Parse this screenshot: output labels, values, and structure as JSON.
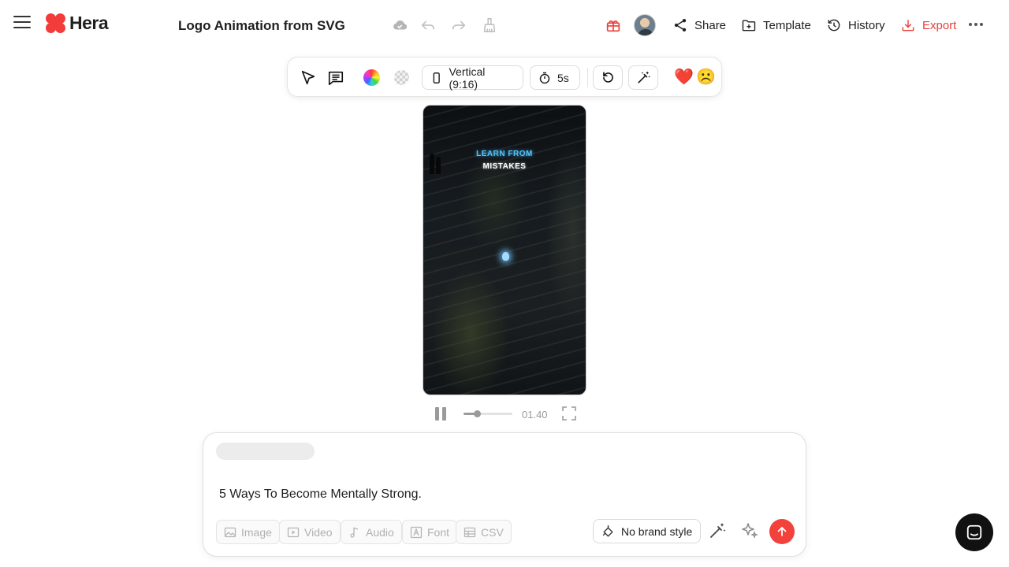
{
  "header": {
    "app_name": "Hera",
    "document_title": "Logo Animation from SVG",
    "actions": {
      "share": "Share",
      "template": "Template",
      "history": "History",
      "export": "Export"
    },
    "icons": [
      "menu-icon",
      "cloud-saved-icon",
      "undo-icon",
      "redo-icon",
      "cleanup-brush-icon",
      "gift-icon",
      "avatar",
      "share-icon",
      "template-icon",
      "history-icon",
      "export-icon",
      "more-icon"
    ]
  },
  "toolbar": {
    "orientation_label": "Vertical (9:16)",
    "duration_label": "5s",
    "icons": [
      "select-cursor-icon",
      "comment-icon",
      "color-wheel-icon",
      "transparency-icon",
      "phone-icon",
      "timer-icon",
      "reset-icon",
      "magic-wand-icon",
      "heart-icon",
      "frown-icon"
    ],
    "reactions": {
      "like": "❤️",
      "dislike": "☹️"
    }
  },
  "preview": {
    "line1": "LEARN FROM",
    "line2": "MISTAKES"
  },
  "playback": {
    "time": "01.40",
    "progress": 0.27
  },
  "prompt": {
    "text": "5 Ways To Become Mentally Strong.",
    "attachments": [
      "Image",
      "Video",
      "Audio",
      "Font",
      "CSV"
    ],
    "brand_style_label": "No brand style"
  },
  "colors": {
    "accent": "#f2423b",
    "brand": "#f23c3c",
    "text": "#1f1f1f",
    "muted": "#9a9a9a"
  }
}
